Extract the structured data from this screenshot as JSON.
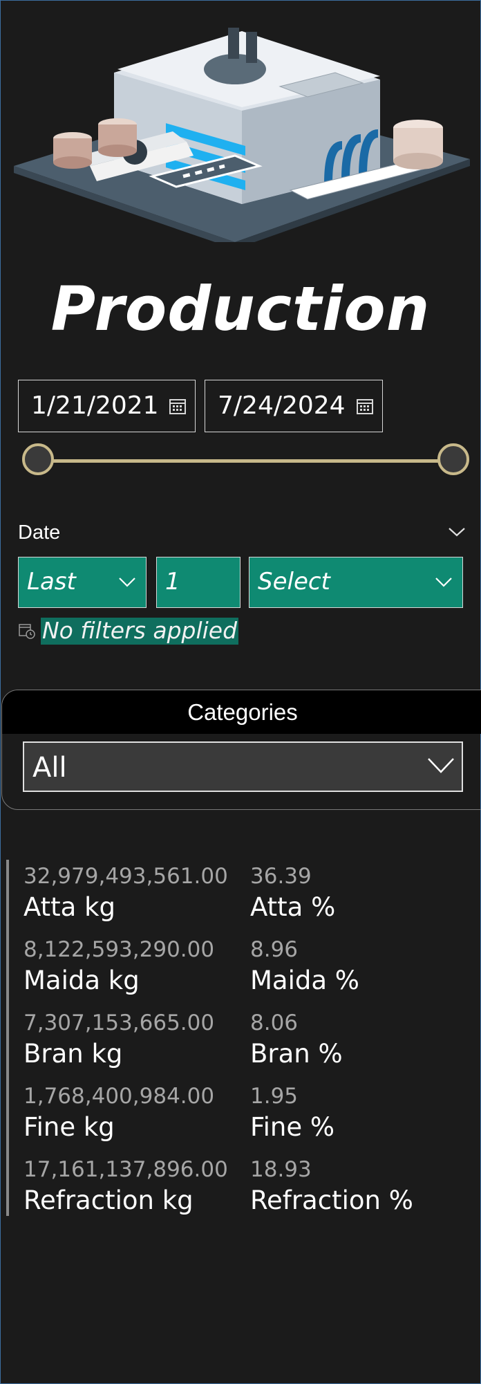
{
  "header": {
    "title": "Production"
  },
  "date_range": {
    "start": "1/21/2021",
    "end": "7/24/2024"
  },
  "date_filter": {
    "label": "Date",
    "mode": "Last",
    "count": "1",
    "unit_placeholder": "Select",
    "status": "No filters applied"
  },
  "categories": {
    "title": "Categories",
    "selected": "All"
  },
  "kpis": [
    {
      "kg_value": "32,979,493,561.00",
      "kg_label": "Atta kg",
      "pct_value": "36.39",
      "pct_label": "Atta %"
    },
    {
      "kg_value": "8,122,593,290.00",
      "kg_label": "Maida kg",
      "pct_value": "8.96",
      "pct_label": "Maida %"
    },
    {
      "kg_value": "7,307,153,665.00",
      "kg_label": "Bran kg",
      "pct_value": "8.06",
      "pct_label": "Bran %"
    },
    {
      "kg_value": "1,768,400,984.00",
      "kg_label": "Fine kg",
      "pct_value": "1.95",
      "pct_label": "Fine %"
    },
    {
      "kg_value": "17,161,137,896.00",
      "kg_label": "Refraction kg",
      "pct_value": "18.93",
      "pct_label": "Refraction %"
    }
  ],
  "icons": {
    "factory": "factory-illustration",
    "calendar": "calendar-icon",
    "chevron": "chevron-down-icon",
    "filter_date": "calendar-clock-icon"
  },
  "colors": {
    "background": "#1b1b1b",
    "accent_green": "#0f8a72",
    "slider": "#c8b98a"
  }
}
